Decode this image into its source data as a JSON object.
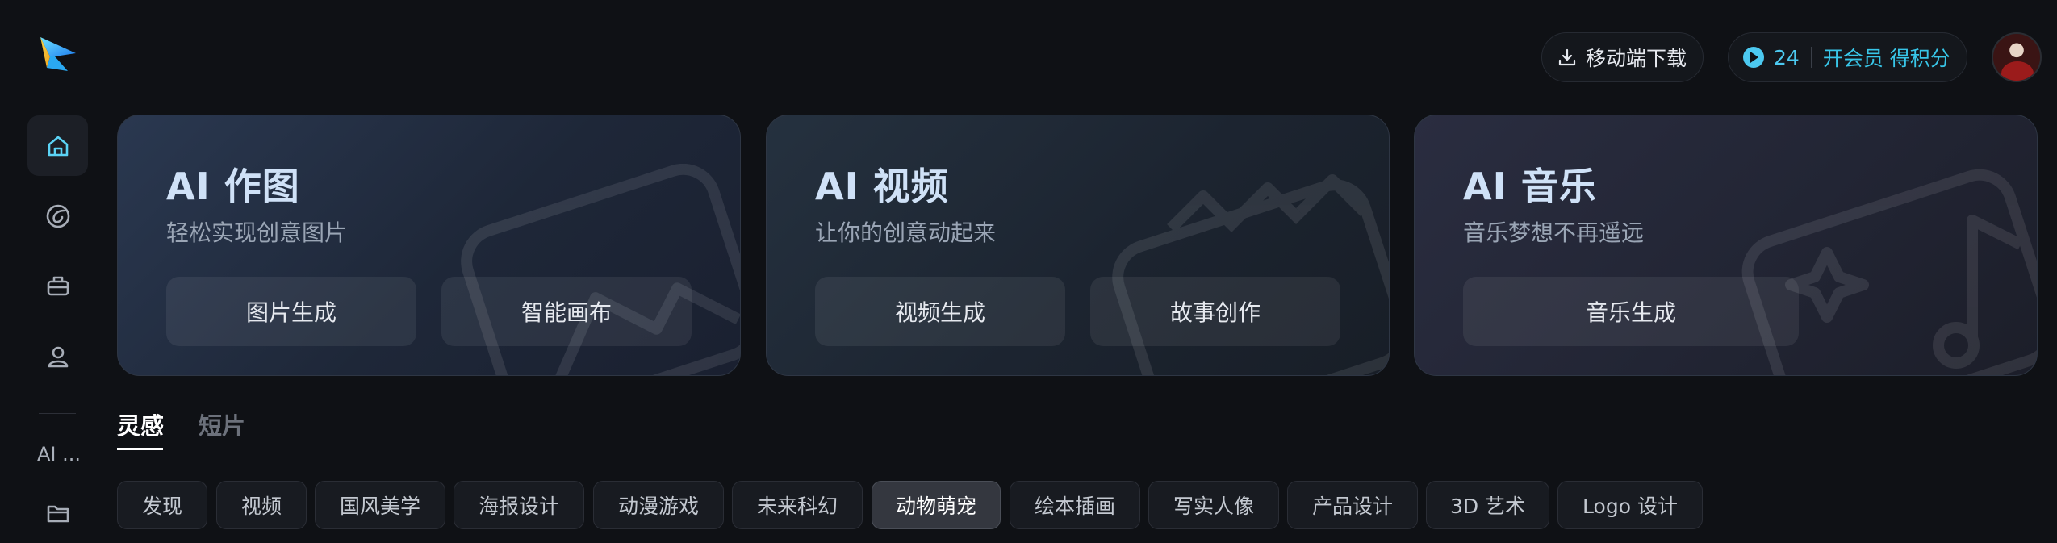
{
  "sidebar": {
    "items": [
      {
        "icon": "home-icon",
        "active": true
      },
      {
        "icon": "swirl-icon"
      },
      {
        "icon": "toolbox-icon"
      },
      {
        "icon": "user-icon"
      }
    ],
    "ai_label": "AI ...",
    "bottom_icon": "folder-icon"
  },
  "header": {
    "download_label": "移动端下载",
    "points": "24",
    "vip_label": "开会员 得积分"
  },
  "cards": [
    {
      "title": "AI 作图",
      "subtitle": "轻松实现创意图片",
      "buttons": [
        "图片生成",
        "智能画布"
      ]
    },
    {
      "title": "AI 视频",
      "subtitle": "让你的创意动起来",
      "buttons": [
        "视频生成",
        "故事创作"
      ]
    },
    {
      "title": "AI 音乐",
      "subtitle": "音乐梦想不再遥远",
      "buttons": [
        "音乐生成"
      ]
    }
  ],
  "tabs": [
    {
      "label": "灵感",
      "active": true
    },
    {
      "label": "短片",
      "active": false
    }
  ],
  "categories": {
    "selected": "动物萌宠",
    "items": [
      "发现",
      "视频",
      "国风美学",
      "海报设计",
      "动漫游戏",
      "未来科幻",
      "动物萌宠",
      "绘本插画",
      "写实人像",
      "产品设计",
      "3D 艺术",
      "Logo 设计"
    ]
  },
  "colors": {
    "accent": "#38c6e8",
    "background": "#0f1115"
  }
}
